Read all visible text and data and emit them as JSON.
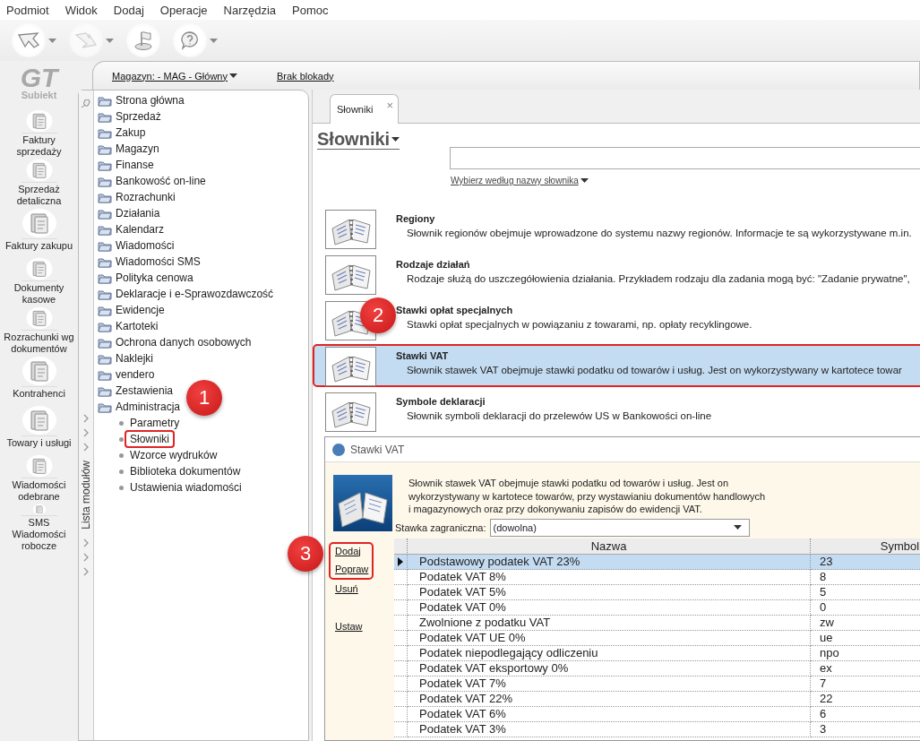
{
  "menu": [
    "Podmiot",
    "Widok",
    "Dodaj",
    "Operacje",
    "Narzędzia",
    "Pomoc"
  ],
  "toolbar": [
    {
      "kind": "back",
      "disabled": false,
      "dropdown": true
    },
    {
      "kind": "forward",
      "disabled": true,
      "dropdown": true
    },
    {
      "kind": "flag",
      "disabled": false,
      "dropdown": false
    },
    {
      "kind": "help",
      "disabled": false,
      "dropdown": true
    }
  ],
  "logo": {
    "mark": "GT",
    "name": "Subiekt"
  },
  "sidebar": {
    "items": [
      "Faktury sprzedaży",
      "Sprzedaż detaliczna",
      "Faktury zakupu",
      "Dokumenty kasowe",
      "Rozrachunki wg dokumentów",
      "Kontrahenci",
      "Towary i usługi",
      "Wiadomości odebrane",
      "SMS Wiadomości robocze"
    ]
  },
  "top_bar": {
    "warehouse": "Magazyn: - MAG - Główny",
    "lock": "Brak blokady"
  },
  "module_list": {
    "title": "Lista modułów",
    "items": [
      {
        "label": "Strona główna"
      },
      {
        "label": "Sprzedaż"
      },
      {
        "label": "Zakup"
      },
      {
        "label": "Magazyn"
      },
      {
        "label": "Finanse"
      },
      {
        "label": "Bankowość on-line"
      },
      {
        "label": "Rozrachunki"
      },
      {
        "label": "Działania"
      },
      {
        "label": "Kalendarz"
      },
      {
        "label": "Wiadomości"
      },
      {
        "label": "Wiadomości SMS"
      },
      {
        "label": "Polityka cenowa"
      },
      {
        "label": "Deklaracje i e-Sprawozdawczość"
      },
      {
        "label": "Ewidencje"
      },
      {
        "label": "Kartoteki"
      },
      {
        "label": "Ochrona danych osobowych"
      },
      {
        "label": "Naklejki"
      },
      {
        "label": "vendero"
      },
      {
        "label": "Zestawienia"
      },
      {
        "label": "Administracja",
        "children": [
          {
            "label": "Parametry",
            "highlighted": false
          },
          {
            "label": "Słowniki",
            "highlighted": true
          },
          {
            "label": "Wzorce wydruków",
            "highlighted": false
          },
          {
            "label": "Biblioteka dokumentów",
            "highlighted": false
          },
          {
            "label": "Ustawienia wiadomości",
            "highlighted": false
          }
        ]
      }
    ]
  },
  "tabs": [
    {
      "label": "Słowniki",
      "selected": true,
      "close": "×"
    }
  ],
  "page": {
    "title": "Słowniki",
    "filter_link": "Wybierz według nazwy słownika"
  },
  "dictionaries": [
    {
      "title": "Regiony",
      "description": "Słownik regionów obejmuje wprowadzone do systemu nazwy regionów. Informacje te są wykorzystywane m.in.",
      "selected": false,
      "highlighted": false
    },
    {
      "title": "Rodzaje działań",
      "description": "Rodzaje służą do uszczegółowienia działania. Przykładem rodzaju dla zadania mogą być: \"Zadanie prywatne\",",
      "selected": false,
      "highlighted": false
    },
    {
      "title": "Stawki opłat specjalnych",
      "description": "Stawki opłat specjalnych w powiązaniu z towarami, np. opłaty recyklingowe.",
      "selected": false,
      "highlighted": false
    },
    {
      "title": "Stawki VAT",
      "description": "Słownik stawek VAT obejmuje stawki podatku od towarów i usług. Jest on wykorzystywany w kartotece towar",
      "selected": true,
      "highlighted": true
    },
    {
      "title": "Symbole deklaracji",
      "description": "Słownik symboli deklaracji do przelewów US w Bankowości on-line",
      "selected": false,
      "highlighted": false
    }
  ],
  "dialog": {
    "title": "Stawki VAT",
    "description": "Słownik stawek VAT obejmuje stawki podatku od towarów i usług. Jest on wykorzystywany w kartotece towarów, przy wystawianiu dokumentów handlowych i magazynowych oraz przy dokonywaniu zapisów do ewidencji VAT.",
    "filter_label": "Stawka zagraniczna:",
    "filter_value": "(dowolna)",
    "actions": [
      {
        "label": "Dodaj",
        "highlighted": true
      },
      {
        "label": "Popraw",
        "highlighted": true
      },
      {
        "label": "Usuń",
        "highlighted": false
      },
      {
        "label": "Ustaw",
        "highlighted": false
      }
    ],
    "table": {
      "columns": [
        "Nazwa",
        "Symbol"
      ],
      "rows": [
        {
          "name": "Podstawowy podatek VAT 23%",
          "symbol": "23",
          "selected": true
        },
        {
          "name": "Podatek VAT 8%",
          "symbol": "8",
          "selected": false
        },
        {
          "name": "Podatek VAT 5%",
          "symbol": "5",
          "selected": false
        },
        {
          "name": "Podatek VAT 0%",
          "symbol": "0",
          "selected": false
        },
        {
          "name": "Zwolnione z podatku VAT",
          "symbol": "zw",
          "selected": false
        },
        {
          "name": "Podatek VAT UE 0%",
          "symbol": "ue",
          "selected": false
        },
        {
          "name": "Podatek niepodlegający odliczeniu",
          "symbol": "npo",
          "selected": false
        },
        {
          "name": "Podatek VAT eksportowy 0%",
          "symbol": "ex",
          "selected": false
        },
        {
          "name": "Podatek VAT 7%",
          "symbol": "7",
          "selected": false
        },
        {
          "name": "Podatek VAT 22%",
          "symbol": "22",
          "selected": false
        },
        {
          "name": "Podatek VAT 6%",
          "symbol": "6",
          "selected": false
        },
        {
          "name": "Podatek VAT 3%",
          "symbol": "3",
          "selected": false
        }
      ]
    }
  },
  "annotations": [
    {
      "number": "1"
    },
    {
      "number": "2"
    },
    {
      "number": "3"
    }
  ]
}
